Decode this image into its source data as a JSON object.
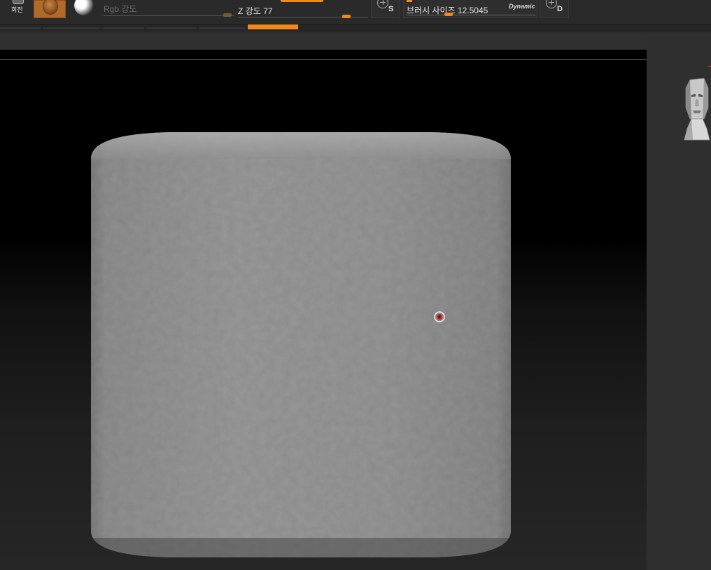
{
  "toolbar": {
    "rotate_label": "회전",
    "rgb_intensity_label": "Rgb 강도",
    "z_intensity_label": "Z 강도",
    "z_intensity_value": "77",
    "s_button_letter": "S",
    "brush_size_label": "브러시 사이즈",
    "brush_size_value": "12.5045",
    "dynamic_label": "Dynamic",
    "d_button_letter": "D"
  },
  "sliders": {
    "z_intensity_fraction": 0.77,
    "brush_size_fraction": 0.3
  },
  "colors": {
    "accent_orange": "#f08a1c",
    "viewport_background": "#000000",
    "ui_background": "#2c2c2c",
    "model_gray": "#8c8c8c",
    "cursor_red": "#c02020"
  },
  "icons": {
    "rotate": "rotate-icon",
    "material": "material-sphere-icon",
    "texture": "texture-sphere-icon",
    "add_circle": "circle-plus-icon",
    "orientation": "head-orientation-icon",
    "brush_cursor": "brush-cursor-icon"
  }
}
